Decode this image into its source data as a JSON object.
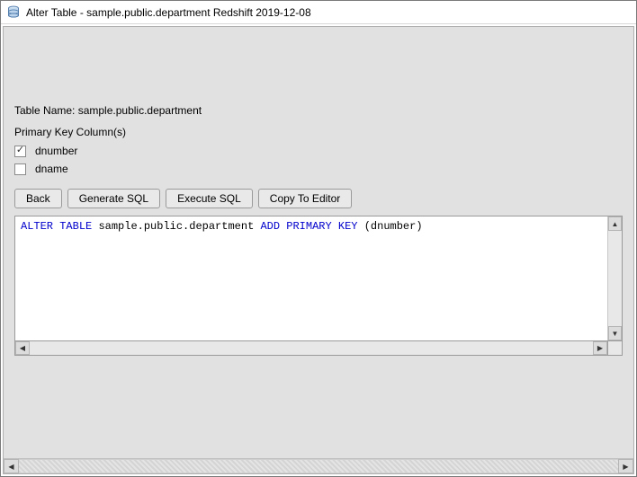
{
  "window": {
    "title": "Alter Table - sample.public.department Redshift 2019-12-08"
  },
  "labels": {
    "table_name_prefix": "Table Name: ",
    "table_name_value": "sample.public.department",
    "pk_section": "Primary Key Column(s)"
  },
  "pk_columns": [
    {
      "name": "dnumber",
      "checked": true
    },
    {
      "name": "dname",
      "checked": false
    }
  ],
  "buttons": {
    "back": "Back",
    "generate": "Generate SQL",
    "execute": "Execute SQL",
    "copy": "Copy To Editor"
  },
  "sql": {
    "kw1": "ALTER",
    "kw2": "TABLE",
    "obj": "sample.public.department",
    "kw3": "ADD",
    "kw4": "PRIMARY",
    "kw5": "KEY",
    "args": "(dnumber)"
  }
}
